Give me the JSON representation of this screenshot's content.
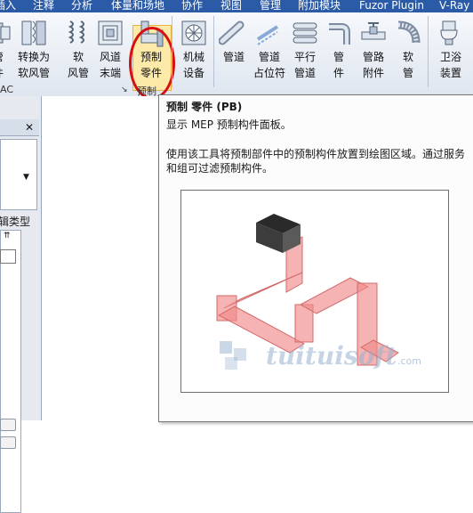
{
  "menu": [
    "插入",
    "注释",
    "分析",
    "体量和场地",
    "协作",
    "视图",
    "管理",
    "附加模块",
    "Fuzor Plugin",
    "V-Ray"
  ],
  "ribbon": {
    "buttons": [
      {
        "line1": "管",
        "line2": "件"
      },
      {
        "line1": "转换为",
        "line2": "软风管"
      },
      {
        "line1": "软",
        "line2": "风管"
      },
      {
        "line1": "风道",
        "line2": "末端"
      },
      {
        "line1": "预制",
        "line2": "零件"
      },
      {
        "line1": "机械",
        "line2": "设备"
      },
      {
        "line1": "管道",
        "line2": ""
      },
      {
        "line1": "管道",
        "line2": "占位符"
      },
      {
        "line1": "平行",
        "line2": "管道"
      },
      {
        "line1": "管",
        "line2": "件"
      },
      {
        "line1": "管路",
        "line2": "附件"
      },
      {
        "line1": "软",
        "line2": "管"
      },
      {
        "line1": "卫浴",
        "line2": "装置"
      }
    ],
    "group_hvac": "AC",
    "group_prefab": "预制"
  },
  "left_panel": {
    "close": "✕",
    "dropdown_arrow": "▼",
    "type_label": "编辑类型",
    "collapse_icon": "⇈"
  },
  "tooltip": {
    "title": "预制 零件 (PB)",
    "description": "显示 MEP 预制构件面板。",
    "detail": "使用该工具将预制部件中的预制构件放置到绘图区域。通过服务和组可过滤预制构件。"
  },
  "watermark": {
    "text": "tuituisoft",
    "suffix": ".com"
  },
  "colors": {
    "ribbon_top": "#2b5aa6",
    "highlight_ring": "#d61010",
    "duct": "#f08a8a"
  }
}
